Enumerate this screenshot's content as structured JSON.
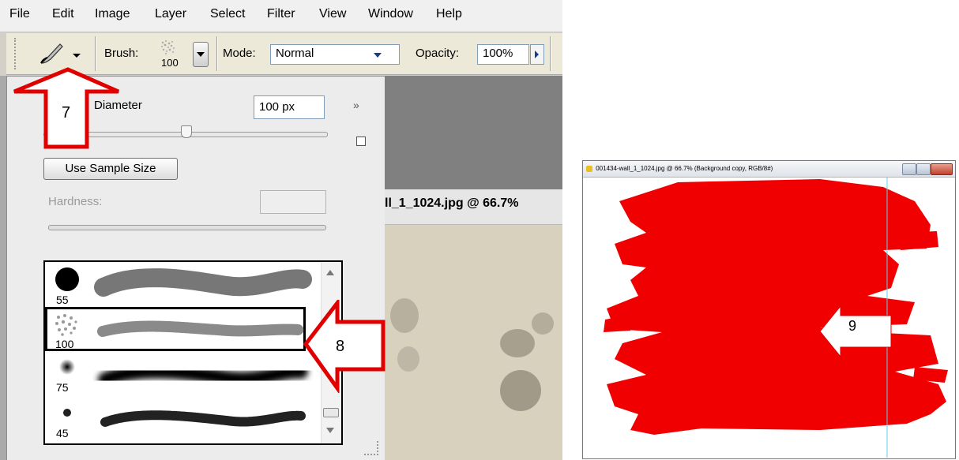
{
  "menu": {
    "items": [
      "File",
      "Edit",
      "Image",
      "Layer",
      "Select",
      "Filter",
      "View",
      "Window",
      "Help"
    ]
  },
  "options_bar": {
    "brush_label": "Brush:",
    "brush_size": "100",
    "mode_label": "Mode:",
    "mode_value": "Normal",
    "opacity_label": "Opacity:",
    "opacity_value": "100%"
  },
  "brush_popup": {
    "diameter_label": "Diameter",
    "diameter_value": "100 px",
    "use_sample_size_label": "Use Sample Size",
    "hardness_label": "Hardness:",
    "hardness_value": "",
    "diameter_slider_fraction": 0.5,
    "brushes": [
      {
        "size": "55",
        "style": "hard"
      },
      {
        "size": "100",
        "style": "textured",
        "selected": true
      },
      {
        "size": "75",
        "style": "soft"
      },
      {
        "size": "45",
        "style": "rough"
      }
    ]
  },
  "document": {
    "title_fragment": "ll_1_1024.jpg @ 66.7%"
  },
  "annotations": {
    "label_7": "7",
    "label_8": "8",
    "label_9": "9",
    "arrow_color": "#e00000"
  },
  "result_window": {
    "title": "001434-wall_1_1024.jpg @ 66.7% (Background copy, RGB/8#)",
    "paint_color": "#f00000"
  }
}
